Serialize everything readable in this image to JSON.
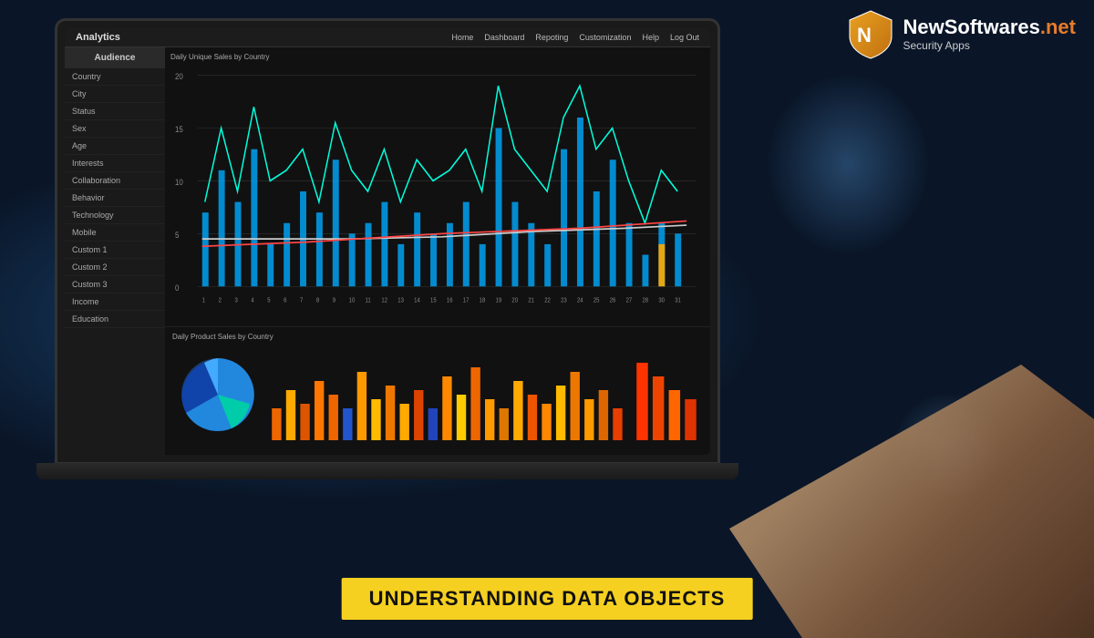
{
  "brand": {
    "name_start": "NewSoftwares",
    "name_end": ".net",
    "tagline": "Security Apps"
  },
  "nav": {
    "title": "Analytics",
    "links": [
      "Home",
      "Dashboard",
      "Repoting",
      "Customization",
      "Help",
      "Log Out"
    ]
  },
  "sidebar": {
    "header": "Audience",
    "items": [
      "Country",
      "City",
      "Status",
      "Sex",
      "Age",
      "Interests",
      "Collaboration",
      "Behavior",
      "Technology",
      "Mobile",
      "Custom 1",
      "Custom 2",
      "Custom 3",
      "Income",
      "Education"
    ]
  },
  "charts": {
    "top_title": "Daily Unique Sales by Country",
    "bottom_title": "Daily Product Sales by Country"
  },
  "banner": {
    "text": "UNDERSTANDING DATA OBJECTS"
  }
}
